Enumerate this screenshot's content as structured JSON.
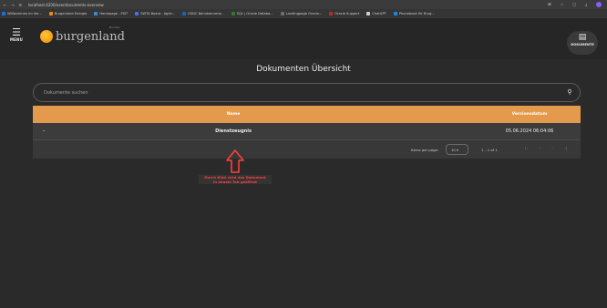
{
  "browser": {
    "nav_back": "←",
    "nav_forward": "→",
    "nav_reload": "⟳",
    "url": "localhost:4200/user/documents-overview",
    "icons": [
      "translate-icon",
      "star-icon",
      "extensions-icon",
      "download-icon",
      "profile-icon"
    ]
  },
  "bookmarks": [
    {
      "label": "Willkommen im Ver...",
      "color": "#1a73e8"
    },
    {
      "label": "Burgenland Energie",
      "color": "#f08b00"
    },
    {
      "label": "Homepage - PSIT",
      "color": "#3b8bd6"
    },
    {
      "label": "SWTA Board - Agile...",
      "color": "#4c6ef5"
    },
    {
      "label": "OSDC Benutzerverw...",
      "color": "#1565c0"
    },
    {
      "label": "SQL | Oracle Databa...",
      "color": "#2e7d32"
    },
    {
      "label": "Landingpage Oracle...",
      "color": "#6d6d6d"
    },
    {
      "label": "Oracle Support",
      "color": "#c62828"
    },
    {
      "label": "ChatGPT",
      "color": "#cfcfcf"
    },
    {
      "label": "Phonebook für Burg...",
      "color": "#1e88e5"
    }
  ],
  "header": {
    "menu_icon": "☰",
    "menu_label": "MENU",
    "logo_text": "burgenland",
    "logo_small": "Bundes",
    "docs_icon": "▤",
    "docs_label": "DOKUMENTE"
  },
  "page": {
    "title": "Dokumenten Übersicht",
    "search_placeholder": "Dokumente suchen",
    "search_icon": "🔍"
  },
  "table": {
    "columns": [
      "Name",
      "Versionsdatum"
    ],
    "rows": [
      {
        "chevron": "⌄",
        "name": "Dienstzeugnis",
        "date": "05.06.2024 06:04:06"
      }
    ],
    "paginator": {
      "items_per_page_label": "Items per page:",
      "page_size": "10 ▾",
      "range": "1 – 1 of 1",
      "first": "|‹",
      "prev": "‹",
      "next": "›",
      "last": "›|"
    }
  },
  "annotation": {
    "line1": "Durch Klick wird das Dokument",
    "line2": "in neuem Tab geöffnet",
    "color": "#ff4040"
  },
  "colors": {
    "accent": "#e39a4c",
    "background": "#2a2a2a"
  }
}
